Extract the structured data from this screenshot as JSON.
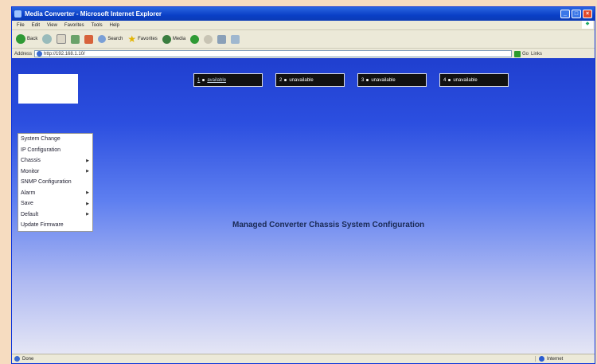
{
  "window": {
    "title": "Media Converter - Microsoft Internet Explorer",
    "controls": {
      "minimize": "_",
      "maximize": "□",
      "close": "×"
    }
  },
  "menubar": [
    "File",
    "Edit",
    "View",
    "Favorites",
    "Tools",
    "Help"
  ],
  "toolbar": {
    "back": "Back",
    "search": "Search",
    "favorites": "Favorites",
    "media": "Media"
  },
  "addressbar": {
    "label": "Address",
    "url": "http://192.168.1.10/",
    "go": "Go",
    "links": "Links"
  },
  "slots": [
    {
      "num": "1",
      "status": "available"
    },
    {
      "num": "2",
      "status": "unavailable"
    },
    {
      "num": "3",
      "status": "unavailable"
    },
    {
      "num": "4",
      "status": "unavailable"
    }
  ],
  "menu": [
    {
      "label": "System Change",
      "submenu": false
    },
    {
      "label": "IP Configuration",
      "submenu": false
    },
    {
      "label": "Chassis",
      "submenu": true
    },
    {
      "label": "Monitor",
      "submenu": true
    },
    {
      "label": "SNMP Configuration",
      "submenu": false
    },
    {
      "label": "Alarm",
      "submenu": true
    },
    {
      "label": "Save",
      "submenu": true
    },
    {
      "label": "Default",
      "submenu": true
    },
    {
      "label": "Update Firmware",
      "submenu": false
    }
  ],
  "main": {
    "heading": "Managed Converter Chassis System Configuration"
  },
  "status": {
    "left": "Done",
    "right": "Internet"
  },
  "colors": {
    "content_top": "#1f3fcf",
    "content_bottom": "#e6e7f5",
    "titlebar": "#0a3fc6"
  }
}
